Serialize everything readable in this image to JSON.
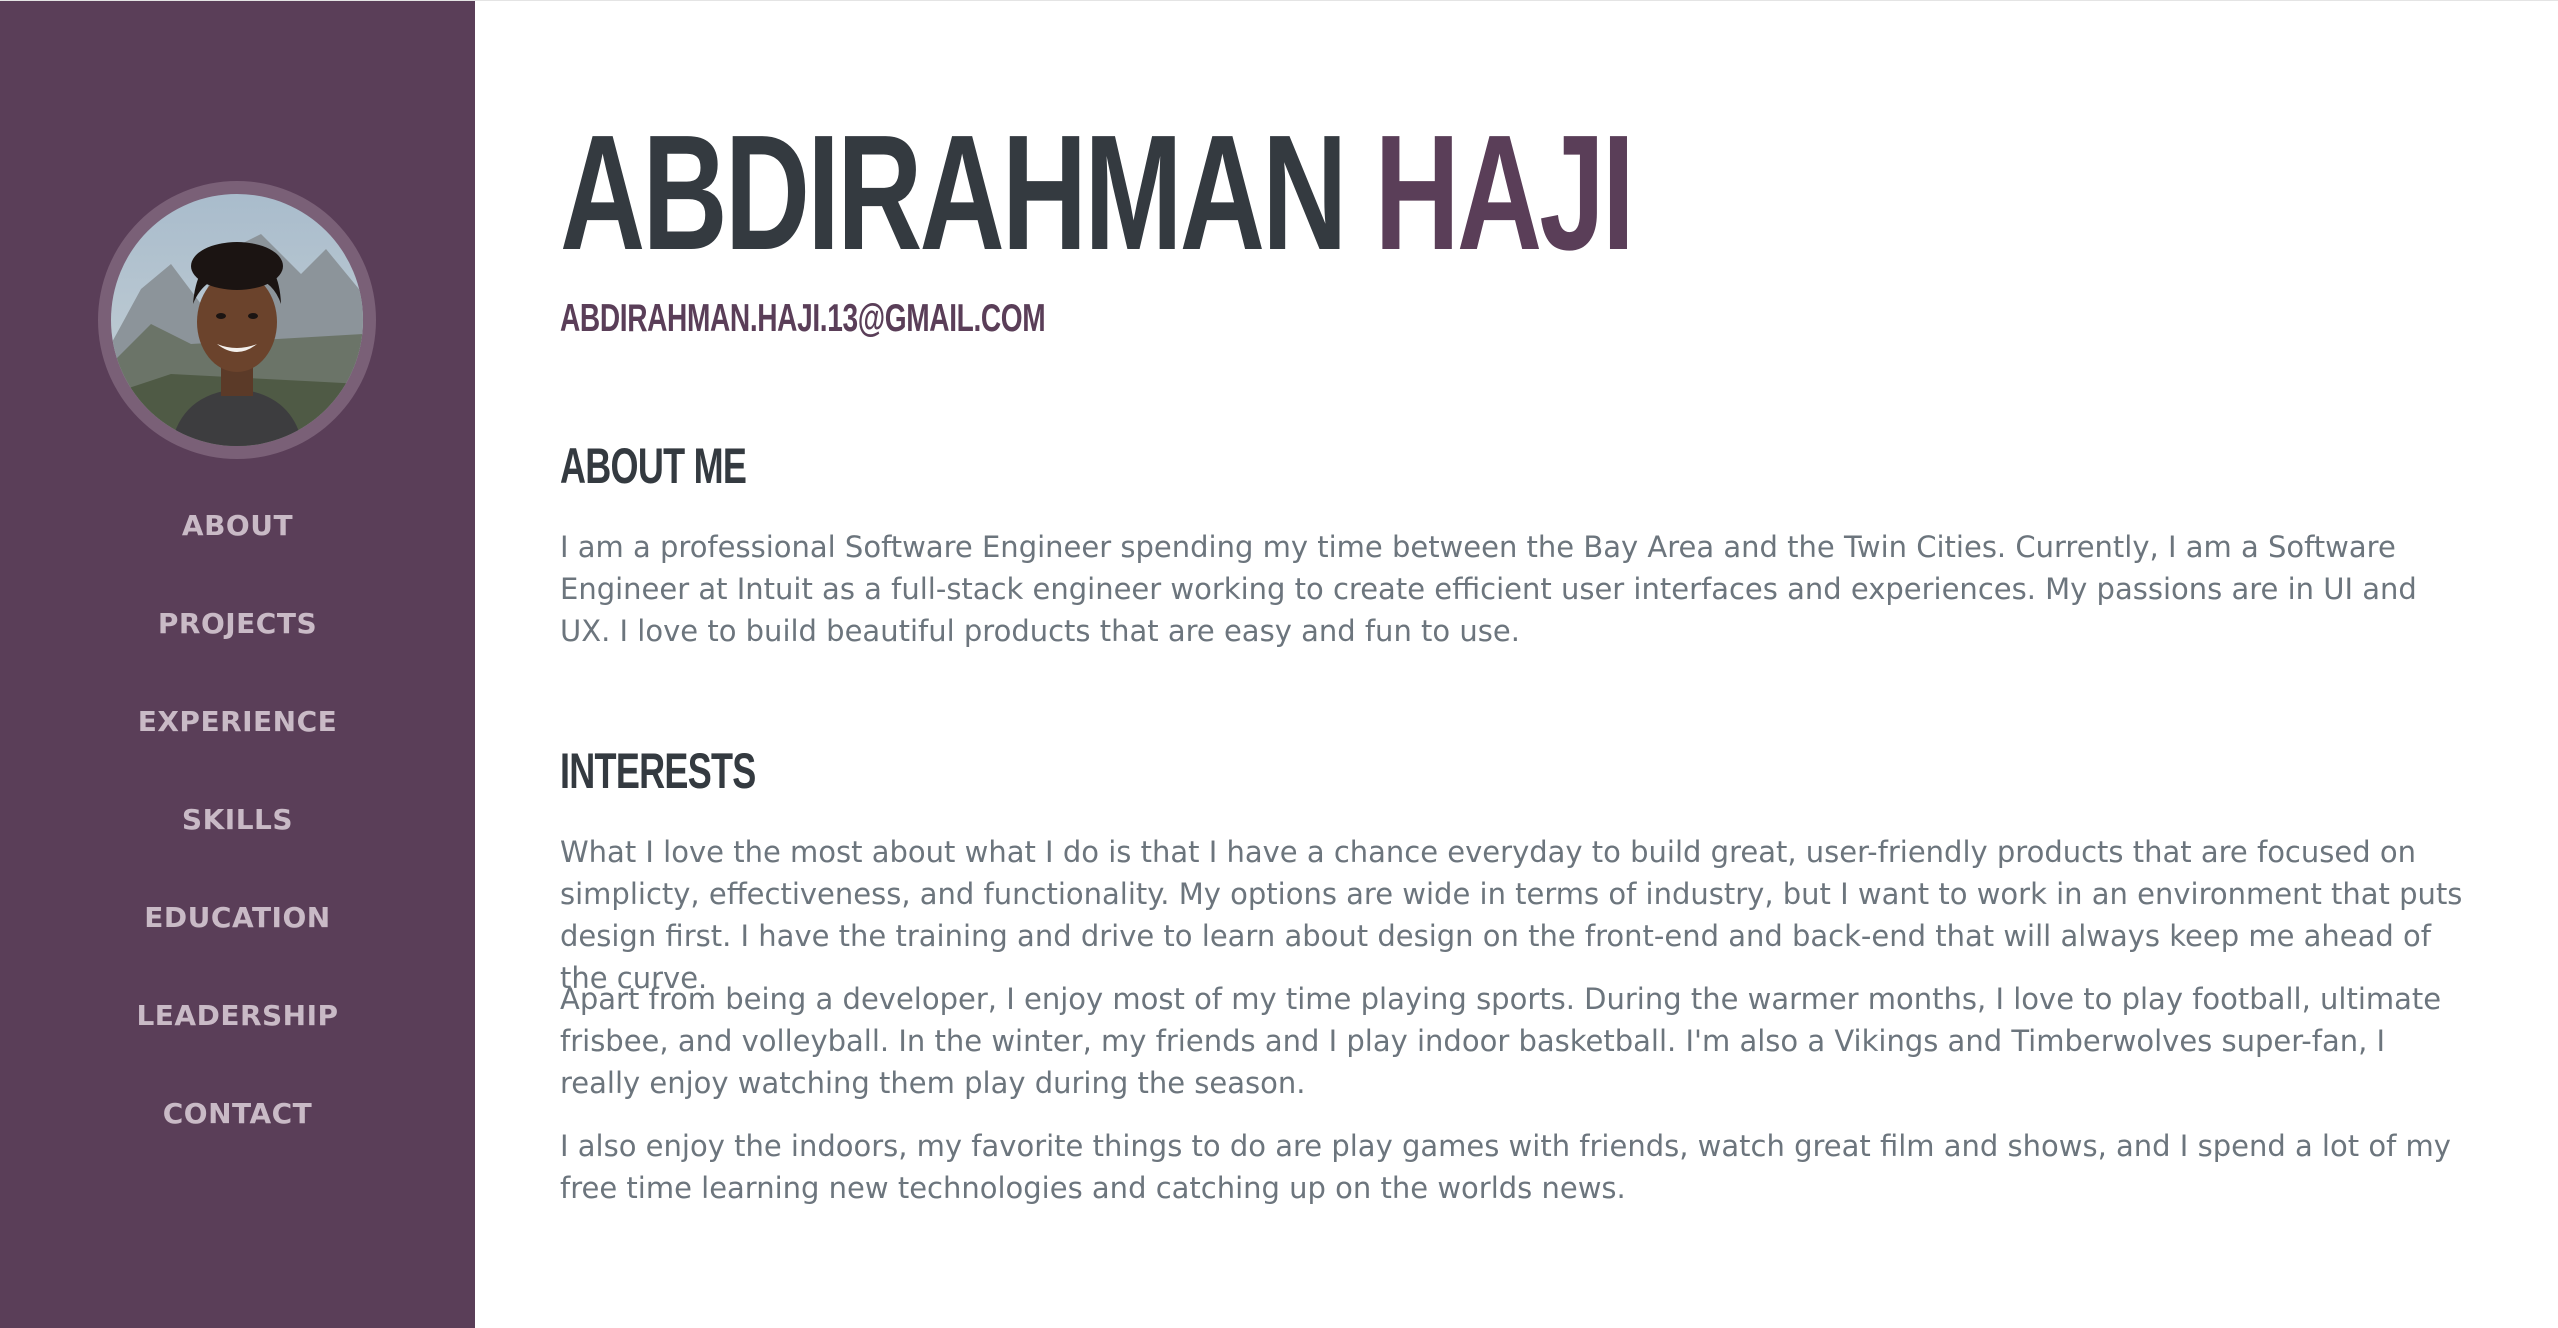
{
  "profile": {
    "first_name": "ABDIRAHMAN",
    "last_name": "HAJI",
    "email": "ABDIRAHMAN.HAJI.13@GMAIL.COM",
    "avatar_icon": "profile-photo"
  },
  "nav": {
    "items": [
      {
        "label": "ABOUT"
      },
      {
        "label": "PROJECTS"
      },
      {
        "label": "EXPERIENCE"
      },
      {
        "label": "SKILLS"
      },
      {
        "label": "EDUCATION"
      },
      {
        "label": "LEADERSHIP"
      },
      {
        "label": "CONTACT"
      }
    ]
  },
  "about": {
    "title": "ABOUT ME",
    "text": "I am a professional Software Engineer spending my time between the Bay Area and the Twin Cities. Currently, I am a Software Engineer at Intuit as a full-stack engineer working to create efficient user interfaces and experiences. My passions are in UI and UX. I love to build beautiful products that are easy and fun to use."
  },
  "interests": {
    "title": "INTERESTS",
    "paragraphs": [
      "What I love the most about what I do is that I have a chance everyday to build great, user-friendly products that are focused on simplicty, effectiveness, and functionality. My options are wide in terms of industry, but I want to work in an environment that puts design first. I have the training and drive to learn about design on the front-end and back-end that will always keep me ahead of the curve.",
      "Apart from being a developer, I enjoy most of my time playing sports. During the warmer months, I love to play football, ultimate frisbee, and volleyball. In the winter, my friends and I play indoor basketball. I'm also a Vikings and Timberwolves super-fan, I really enjoy watching them play during the season.",
      "I also enjoy the indoors, my favorite things to do are play games with friends, watch great film and shows, and I spend a lot of my free time learning new technologies and catching up on the worlds news."
    ]
  },
  "colors": {
    "sidebar": "#5a3e58",
    "avatar_ring": "#7a6077",
    "nav_text": "#c9bac6",
    "heading": "#343a40",
    "accent": "#5a3e58",
    "body_text": "#6c757d"
  }
}
